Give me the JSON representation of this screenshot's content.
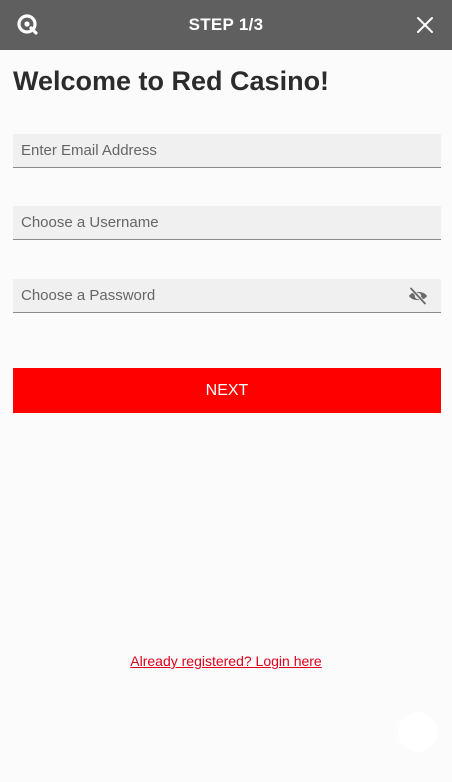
{
  "header": {
    "title": "STEP 1/3",
    "logo_icon": "brand-logo-icon",
    "close_icon": "close-icon",
    "background_color": "#5f5f5f"
  },
  "main": {
    "title": "Welcome to Red Casino!"
  },
  "form": {
    "email": {
      "placeholder": "Enter Email Address",
      "value": ""
    },
    "username": {
      "placeholder": "Choose a Username",
      "value": ""
    },
    "password": {
      "placeholder": "Choose a Password",
      "value": "",
      "toggle_icon": "eye-slash-icon"
    }
  },
  "actions": {
    "next_label": "NEXT",
    "next_color": "#ff0000",
    "login_link": "Already registered? Login here"
  },
  "scroll_top_icon": "arrow-up-icon"
}
